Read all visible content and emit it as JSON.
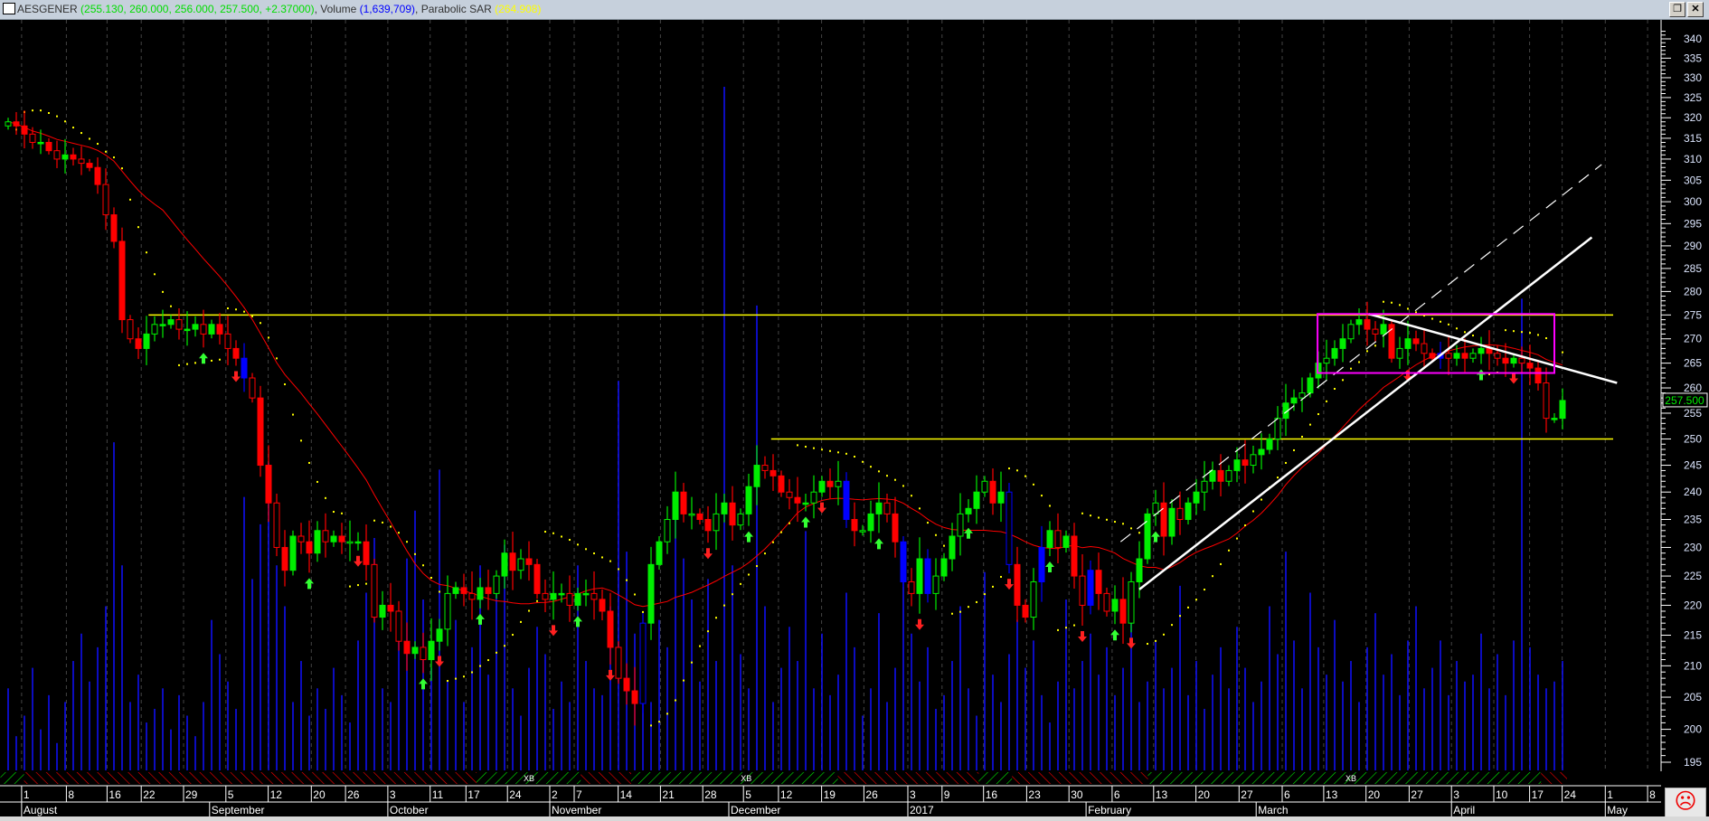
{
  "header": {
    "symbol": "AESGENER",
    "ohlc_text": "(255.130, 260.000, 256.000, 257.500, +2.37000)",
    "volume_label": "Volume",
    "volume_text": "(1,639,709)",
    "sar_label": "Parabolic SAR",
    "sar_text": "(264.908)",
    "restore_icon": "restore-icon",
    "close_icon": "close-icon"
  },
  "colors": {
    "up": "#00ee00",
    "down": "#ff0000",
    "neutral": "#0000ff",
    "ma": "#ff0000",
    "sar": "#ffff00",
    "volume": "#1010ff",
    "level": "#ffff00",
    "box": "#ff00ff",
    "trend": "#ffffff"
  },
  "price_label": "257.500",
  "status_icon": "sad-face-icon",
  "chart_data": {
    "type": "candlestick",
    "title": "AESGENER",
    "scale": "log",
    "ylim": [
      195,
      340
    ],
    "yticks": [
      195,
      200,
      205,
      210,
      215,
      220,
      225,
      230,
      235,
      240,
      245,
      250,
      255,
      260,
      265,
      270,
      275,
      280,
      285,
      290,
      295,
      300,
      305,
      310,
      315,
      320,
      325,
      330,
      335,
      340
    ],
    "close": [
      319,
      318,
      316,
      314,
      314,
      312,
      310,
      311,
      310,
      309,
      308,
      304,
      297,
      291,
      274,
      270,
      268,
      271,
      273,
      273,
      274,
      272,
      272,
      273,
      271,
      273,
      271,
      268,
      266,
      262,
      258,
      245,
      238,
      230,
      226,
      232,
      231,
      229,
      233,
      231,
      232,
      231,
      231,
      231,
      227,
      218,
      220,
      219,
      214,
      212,
      213,
      211,
      214,
      216,
      222,
      223,
      222,
      221,
      223,
      222,
      225,
      229,
      226,
      228,
      227,
      222,
      221,
      222,
      222,
      220,
      222,
      222,
      221,
      219,
      213,
      208,
      206,
      204,
      217,
      227,
      231,
      235,
      240,
      236,
      236,
      235,
      233,
      236,
      238,
      234,
      236,
      241,
      245,
      244,
      243,
      240,
      239,
      238,
      238,
      240,
      242,
      241,
      242,
      235,
      233,
      233,
      236,
      238,
      236,
      231,
      224,
      222,
      228,
      222,
      225,
      228,
      232,
      236,
      237,
      240,
      242,
      238,
      240,
      227,
      220,
      218,
      224,
      230,
      233,
      230,
      232,
      225,
      220,
      226,
      222,
      219,
      221,
      217,
      224,
      228,
      236,
      238,
      232,
      237,
      235,
      238,
      240,
      242,
      244,
      242,
      244,
      246,
      245,
      247,
      248,
      250,
      254,
      257,
      258,
      259,
      262,
      265,
      266,
      268,
      270,
      273,
      274,
      272,
      271,
      273,
      266,
      268,
      270,
      269,
      267,
      266,
      267,
      266,
      267,
      266,
      267,
      268,
      267,
      266,
      265,
      266,
      265,
      264,
      261,
      254,
      254,
      257.5
    ],
    "first_open": 318,
    "volume_millions": [
      1.2,
      0.5,
      0.8,
      1.5,
      0.6,
      1.1,
      0.4,
      1.0,
      1.6,
      2.0,
      1.3,
      1.8,
      2.4,
      4.8,
      3.0,
      1.0,
      1.4,
      0.7,
      0.9,
      1.2,
      0.6,
      1.1,
      0.8,
      0.5,
      1.0,
      2.2,
      1.7,
      1.3,
      0.9,
      4.0,
      2.8,
      3.6,
      4.5,
      3.0,
      2.4,
      1.0,
      1.6,
      0.8,
      1.2,
      0.9,
      1.5,
      1.1,
      0.7,
      1.9,
      2.6,
      3.4,
      1.2,
      1.0,
      2.0,
      3.1,
      3.8,
      2.5,
      1.5,
      4.4,
      1.3,
      2.2,
      1.0,
      1.8,
      3.0,
      1.4,
      2.6,
      3.3,
      1.2,
      0.8,
      1.5,
      2.1,
      1.7,
      0.9,
      1.3,
      1.0,
      3.0,
      1.6,
      1.2,
      1.1,
      2.4,
      5.7,
      3.2,
      2.0,
      1.5,
      1.0,
      2.2,
      1.8,
      4.0,
      3.1,
      2.5,
      1.3,
      2.8,
      1.6,
      10.0,
      3.0,
      1.7,
      1.2,
      6.8,
      2.4,
      1.0,
      1.5,
      2.1,
      1.6,
      3.5,
      1.2,
      2.0,
      1.1,
      1.4,
      2.6,
      1.8,
      0.8,
      1.2,
      2.3,
      1.0,
      1.5,
      3.1,
      2.0,
      1.3,
      1.8,
      0.9,
      1.1,
      1.6,
      2.4,
      1.2,
      0.8,
      2.9,
      1.4,
      1.0,
      1.7,
      2.2,
      1.5,
      1.9,
      1.1,
      0.7,
      1.3,
      2.5,
      1.2,
      1.6,
      2.0,
      1.4,
      1.8,
      1.1,
      1.5,
      2.2,
      1.0,
      1.3,
      1.9,
      1.2,
      1.5,
      2.7,
      1.1,
      1.6,
      0.9,
      1.4,
      1.8,
      1.2,
      2.1,
      1.5,
      1.0,
      1.3,
      2.4,
      1.7,
      3.2,
      1.9,
      1.2,
      2.6,
      1.8,
      1.4,
      2.2,
      1.3,
      1.6,
      1.0,
      1.8,
      2.3,
      1.4,
      1.7,
      1.1,
      1.9,
      2.4,
      1.2,
      1.5,
      1.9,
      1.1,
      1.6,
      1.3,
      1.4,
      2.0,
      1.2,
      1.7,
      1.1,
      1.9,
      6.9,
      1.8,
      1.4,
      1.2,
      1.3,
      1.6
    ],
    "volume_max": 10,
    "neutral_bars": [
      29,
      78,
      103,
      110,
      113,
      123,
      127,
      133,
      176
    ],
    "ma_period": 20,
    "sar": {
      "step": 0.02,
      "max": 0.2
    },
    "signals": {
      "up": [
        24,
        37,
        51,
        58,
        70,
        91,
        98,
        107,
        118,
        128,
        136,
        141,
        181
      ],
      "down": [
        28,
        43,
        53,
        67,
        74,
        86,
        100,
        112,
        123,
        132,
        138,
        172,
        185
      ]
    },
    "levels": [
      {
        "price": 275,
        "from_bar": 17.7
      },
      {
        "price": 250,
        "from_bar": 94.2
      }
    ],
    "trendlines": [
      {
        "style": "solid",
        "from": [
          139,
          222.7
        ],
        "to": [
          194.6,
          291.9
        ]
      },
      {
        "style": "dashed",
        "from": [
          136.7,
          231
        ],
        "to": [
          195.8,
          308.7
        ]
      },
      {
        "style": "solid",
        "from": [
          167.2,
          275.2
        ],
        "to": [
          197.7,
          261
        ]
      }
    ],
    "box": {
      "from_bar": 160.9,
      "to_bar": 190,
      "top": 275.2,
      "bottom": 263
    },
    "trend_bands": [
      {
        "trend": "up",
        "from_bar": -0.5,
        "to_bar": 2.4
      },
      {
        "trend": "down",
        "from_bar": 2.4,
        "to_bar": 58
      },
      {
        "trend": "up",
        "from_bar": 58,
        "to_bar": 70.8
      },
      {
        "trend": "down",
        "from_bar": 70.8,
        "to_bar": 77
      },
      {
        "trend": "up",
        "from_bar": 77,
        "to_bar": 102.4
      },
      {
        "trend": "down",
        "from_bar": 102.4,
        "to_bar": 119.7
      },
      {
        "trend": "up",
        "from_bar": 119.7,
        "to_bar": 123.8
      },
      {
        "trend": "down",
        "from_bar": 123.8,
        "to_bar": 140.5
      },
      {
        "trend": "up",
        "from_bar": 140.5,
        "to_bar": 188.8
      },
      {
        "trend": "down",
        "from_bar": 188.8,
        "to_bar": 192
      }
    ],
    "band_labels": [
      {
        "text": "XB",
        "bar": 64
      },
      {
        "text": "XB",
        "bar": 90.7
      },
      {
        "text": "XB",
        "bar": 165
      }
    ],
    "day_ticks": [
      {
        "label": "1",
        "bar": 2.1
      },
      {
        "label": "8",
        "bar": 7.6
      },
      {
        "label": "16",
        "bar": 12.6
      },
      {
        "label": "22",
        "bar": 16.8
      },
      {
        "label": "29",
        "bar": 22
      },
      {
        "label": "5",
        "bar": 27.2
      },
      {
        "label": "12",
        "bar": 32.4
      },
      {
        "label": "20",
        "bar": 37.7
      },
      {
        "label": "26",
        "bar": 41.9
      },
      {
        "label": "3",
        "bar": 47.1
      },
      {
        "label": "11",
        "bar": 52.3
      },
      {
        "label": "17",
        "bar": 56.7
      },
      {
        "label": "24",
        "bar": 61.8
      },
      {
        "label": "2",
        "bar": 67
      },
      {
        "label": "7",
        "bar": 70
      },
      {
        "label": "14",
        "bar": 75.4
      },
      {
        "label": "21",
        "bar": 80.6
      },
      {
        "label": "28",
        "bar": 85.8
      },
      {
        "label": "5",
        "bar": 90.8
      },
      {
        "label": "12",
        "bar": 95.1
      },
      {
        "label": "19",
        "bar": 100.4
      },
      {
        "label": "26",
        "bar": 105.6
      },
      {
        "label": "3",
        "bar": 111
      },
      {
        "label": "9",
        "bar": 115.2
      },
      {
        "label": "16",
        "bar": 120.3
      },
      {
        "label": "23",
        "bar": 125.6
      },
      {
        "label": "30",
        "bar": 130.8
      },
      {
        "label": "6",
        "bar": 136.1
      },
      {
        "label": "13",
        "bar": 141.2
      },
      {
        "label": "20",
        "bar": 146.4
      },
      {
        "label": "27",
        "bar": 151.7
      },
      {
        "label": "6",
        "bar": 157
      },
      {
        "label": "13",
        "bar": 162.1
      },
      {
        "label": "20",
        "bar": 167.3
      },
      {
        "label": "27",
        "bar": 172.6
      },
      {
        "label": "3",
        "bar": 177.8
      },
      {
        "label": "10",
        "bar": 183
      },
      {
        "label": "17",
        "bar": 187.4
      },
      {
        "label": "24",
        "bar": 191.4
      },
      {
        "label": "1",
        "bar": 196.7
      },
      {
        "label": "8",
        "bar": 201.9
      }
    ],
    "month_ticks": [
      {
        "label": "August",
        "bar": 2.1
      },
      {
        "label": "September",
        "bar": 25.2
      },
      {
        "label": "October",
        "bar": 47.1
      },
      {
        "label": "November",
        "bar": 67
      },
      {
        "label": "December",
        "bar": 89
      },
      {
        "label": "2017",
        "bar": 111
      },
      {
        "label": "February",
        "bar": 132.9
      },
      {
        "label": "March",
        "bar": 153.8
      },
      {
        "label": "April",
        "bar": 177.8
      },
      {
        "label": "May",
        "bar": 196.7
      }
    ]
  }
}
